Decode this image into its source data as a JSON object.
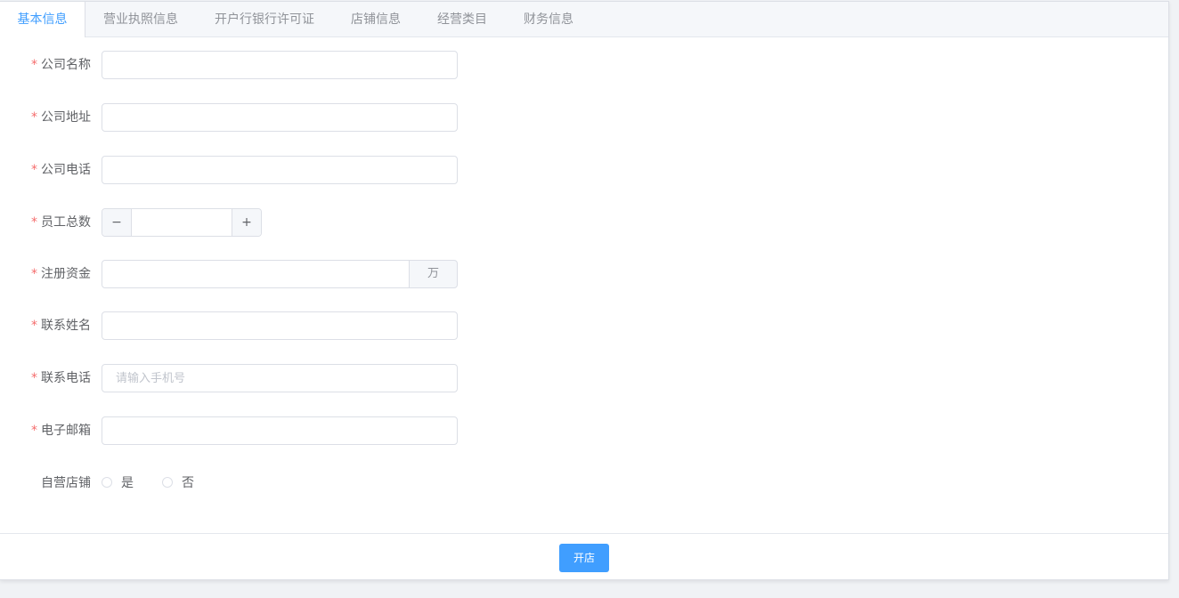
{
  "tabs": [
    {
      "label": "基本信息",
      "active": true
    },
    {
      "label": "营业执照信息",
      "active": false
    },
    {
      "label": "开户行银行许可证",
      "active": false
    },
    {
      "label": "店铺信息",
      "active": false
    },
    {
      "label": "经营类目",
      "active": false
    },
    {
      "label": "财务信息",
      "active": false
    }
  ],
  "form": {
    "required_mark": "*",
    "company_name": {
      "label": "公司名称",
      "value": ""
    },
    "company_address": {
      "label": "公司地址",
      "value": ""
    },
    "company_phone": {
      "label": "公司电话",
      "value": ""
    },
    "employee_count": {
      "label": "员工总数",
      "value": "",
      "minus": "−",
      "plus": "+"
    },
    "registered_capital": {
      "label": "注册资金",
      "value": "",
      "unit": "万"
    },
    "contact_name": {
      "label": "联系姓名",
      "value": ""
    },
    "contact_phone": {
      "label": "联系电话",
      "value": "",
      "placeholder": "请输入手机号"
    },
    "email": {
      "label": "电子邮箱",
      "value": ""
    },
    "self_operated": {
      "label": "自营店铺",
      "options": [
        "是",
        "否"
      ]
    }
  },
  "footer": {
    "submit_label": "开店"
  },
  "colors": {
    "accent": "#409eff",
    "required": "#f56c6c"
  }
}
